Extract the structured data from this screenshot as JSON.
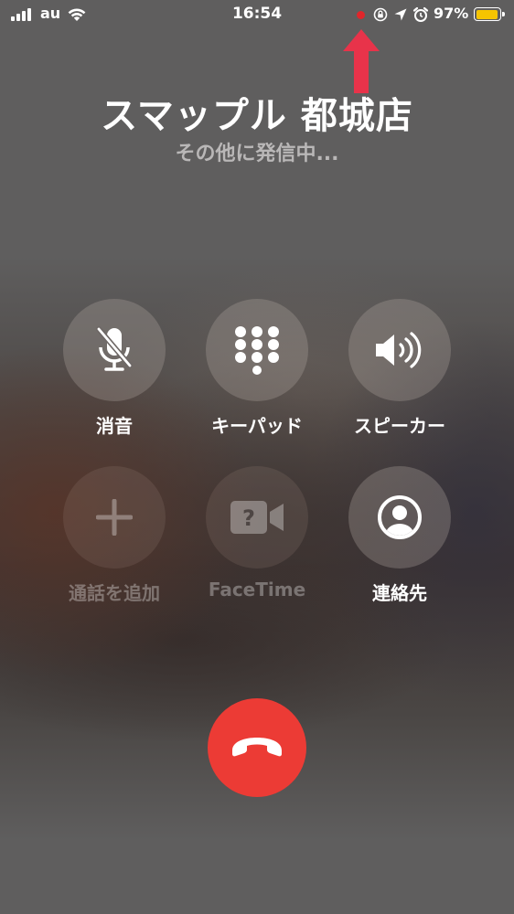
{
  "status_bar": {
    "carrier": "au",
    "time": "16:54",
    "battery_percent": "97%",
    "battery_level": 0.97,
    "battery_color": "#f5c400",
    "recording_dot_color": "#e0262b"
  },
  "annotation": {
    "arrow_color": "#e8334a",
    "icon": "up-arrow-icon"
  },
  "call": {
    "contact_name": "スマップル 都城店",
    "status": "その他に発信中..."
  },
  "controls": [
    {
      "label": "消音",
      "icon": "microphone-muted-icon",
      "enabled": true
    },
    {
      "label": "キーパッド",
      "icon": "keypad-icon",
      "enabled": true
    },
    {
      "label": "スピーカー",
      "icon": "speaker-icon",
      "enabled": true
    },
    {
      "label": "通話を追加",
      "icon": "plus-icon",
      "enabled": false
    },
    {
      "label": "FaceTime",
      "icon": "facetime-icon",
      "enabled": false
    },
    {
      "label": "連絡先",
      "icon": "contact-icon",
      "enabled": true
    }
  ],
  "end_call": {
    "icon": "phone-hangup-icon",
    "color": "#ec3b35"
  }
}
